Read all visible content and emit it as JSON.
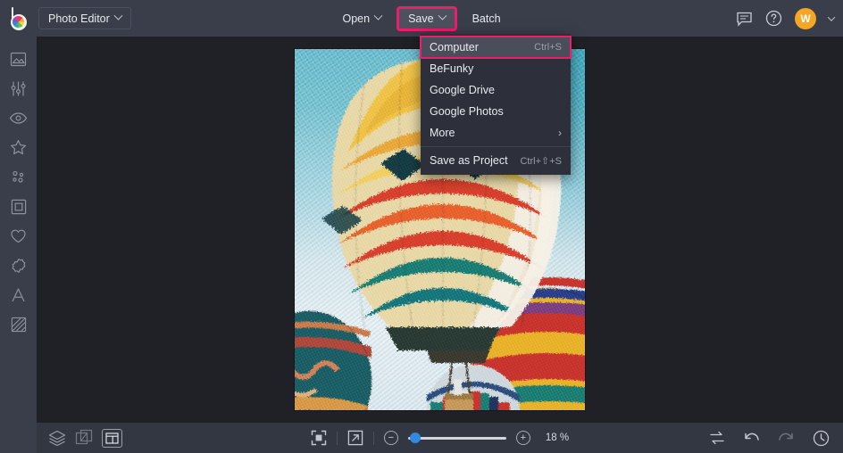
{
  "app": {
    "logo_name": "befunky-logo",
    "product_switcher": "Photo Editor"
  },
  "toolbar": {
    "open_label": "Open",
    "save_label": "Save",
    "batch_label": "Batch"
  },
  "topright": {
    "feedback_icon": "speech-bubble-icon",
    "help_icon": "help-circle-icon",
    "avatar_initial": "W"
  },
  "sidebar": {
    "items": [
      {
        "name": "image",
        "icon": "image-icon"
      },
      {
        "name": "edit",
        "icon": "sliders-icon"
      },
      {
        "name": "touch-up",
        "icon": "eye-icon"
      },
      {
        "name": "effects",
        "icon": "star-icon"
      },
      {
        "name": "artsy",
        "icon": "dots-icon"
      },
      {
        "name": "frames",
        "icon": "frame-icon"
      },
      {
        "name": "overlays",
        "icon": "heart-icon"
      },
      {
        "name": "graphics",
        "icon": "badge-icon"
      },
      {
        "name": "text",
        "icon": "text-a-icon"
      },
      {
        "name": "textures",
        "icon": "texture-icon"
      }
    ]
  },
  "save_menu": {
    "items": [
      {
        "label": "Computer",
        "shortcut": "Ctrl+S",
        "active": true,
        "submenu": false
      },
      {
        "label": "BeFunky",
        "shortcut": "",
        "active": false,
        "submenu": false
      },
      {
        "label": "Google Drive",
        "shortcut": "",
        "active": false,
        "submenu": false
      },
      {
        "label": "Google Photos",
        "shortcut": "",
        "active": false,
        "submenu": false
      },
      {
        "label": "More",
        "shortcut": "",
        "active": false,
        "submenu": true
      }
    ],
    "footer": {
      "label": "Save as Project",
      "shortcut": "Ctrl+⇧+S"
    },
    "submenu_arrow": "›"
  },
  "bottombar": {
    "layers_icon": "layers-icon",
    "transform_icon": "transform-icon",
    "panels_icon": "panel-layout-icon",
    "fit_icon": "fit-to-screen-icon",
    "fullscreen_icon": "expand-arrow-icon",
    "zoom_out_label": "−",
    "zoom_in_label": "+",
    "zoom_value": "18 %",
    "zoom_percent": 18,
    "compare_icon": "compare-swap-icon",
    "undo_icon": "undo-icon",
    "redo_icon": "redo-icon",
    "history_icon": "history-clock-icon"
  },
  "canvas": {
    "image_description": "Hot air balloons painterly effect",
    "background_color": "#1f2126"
  },
  "colors": {
    "topbar": "#3a3e4a",
    "menu_bg": "#2d303a",
    "highlight": "#ec1d6b",
    "accent_blue": "#2f8ae0",
    "avatar_orange": "#f5a623"
  }
}
